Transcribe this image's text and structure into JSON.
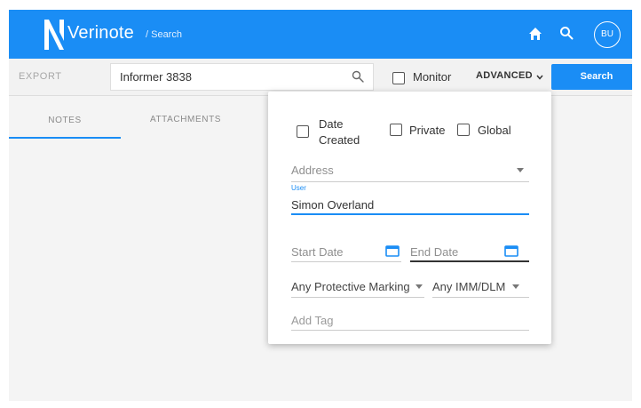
{
  "header": {
    "app_name": "Verinote",
    "breadcrumb": "/ Search",
    "avatar_initials": "BU",
    "colors": {
      "primary": "#1a8df5"
    },
    "icons": [
      "verinote-logo-icon",
      "home-icon",
      "search-icon"
    ]
  },
  "toolbar": {
    "export_label": "EXPORT",
    "search_value": "Informer 3838",
    "monitor_label": "Monitor",
    "monitor_checked": false,
    "advanced_label": "ADVANCED",
    "search_button_label": "Search"
  },
  "tabs": [
    {
      "label": "NOTES",
      "active": true
    },
    {
      "label": "ATTACHMENTS",
      "active": false
    }
  ],
  "advanced_panel": {
    "checkboxes": {
      "date_created_line1": "Date",
      "date_created_line2": "Created",
      "private": "Private",
      "global": "Global"
    },
    "address_placeholder": "Address",
    "user_label": "User",
    "user_value": "Simon Overland",
    "start_date_placeholder": "Start Date",
    "end_date_placeholder": "End Date",
    "protective_marking": "Any Protective Marking",
    "imm_dlm": "Any IMM/DLM",
    "tag_placeholder": "Add Tag"
  }
}
